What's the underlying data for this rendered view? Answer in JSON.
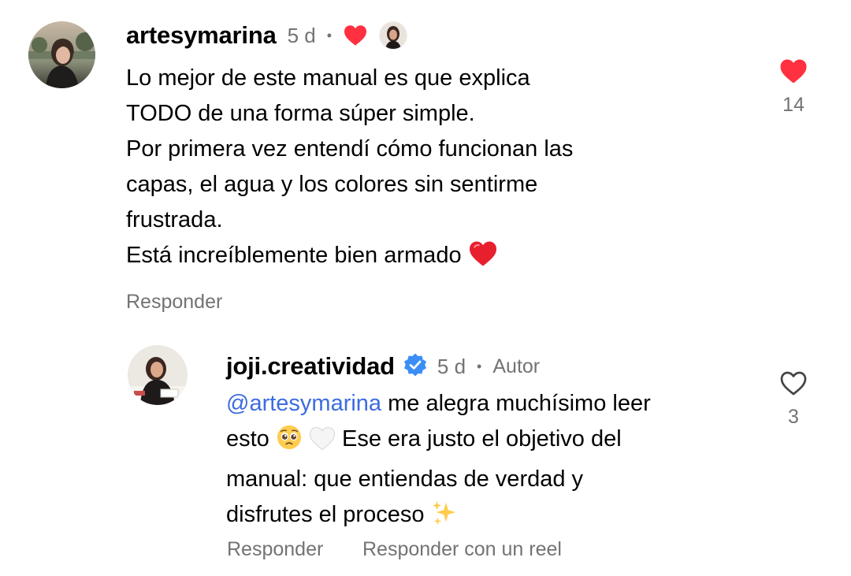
{
  "comment": {
    "username": "artesymarina",
    "time": "5 d",
    "separator": "•",
    "lines": [
      "Lo mejor de este manual es que explica",
      "TODO de una forma súper simple.",
      "Por primera vez entendí cómo funcionan las",
      "capas, el agua y los colores sin sentirme",
      "frustrada.",
      "Está increíblemente bien armado"
    ],
    "reply_label": "Responder",
    "like_count": "14",
    "liked": true,
    "icons": {
      "creator_liked": "heart-icon-red",
      "like": "heart-filled-icon",
      "emoji_end": "red-heart-emoji"
    },
    "colors": {
      "like_red": "#ff3040",
      "meta_gray": "#737373"
    }
  },
  "reply": {
    "username": "joji.creatividad",
    "time": "5 d",
    "separator": "•",
    "author_tag": "Autor",
    "mention": "@artesymarina",
    "line1_rest": " me alegra muchísimo leer",
    "line2_a": "esto",
    "line2_b": "Ese era justo el objetivo del",
    "line3": "manual: que entiendas de verdad y",
    "line4": "disfrutes el proceso",
    "reply_label": "Responder",
    "reel_label": "Responder con un reel",
    "like_count": "3",
    "liked": false,
    "icons": {
      "verified": "verified-badge-icon",
      "like": "heart-outline-icon",
      "emoji_pleading": "pleading-face-emoji",
      "emoji_white_heart": "white-heart-emoji",
      "emoji_sparkles": "sparkles-emoji"
    },
    "colors": {
      "mention_blue": "#3d6ce0",
      "verified_blue": "#3a8ef6"
    }
  }
}
